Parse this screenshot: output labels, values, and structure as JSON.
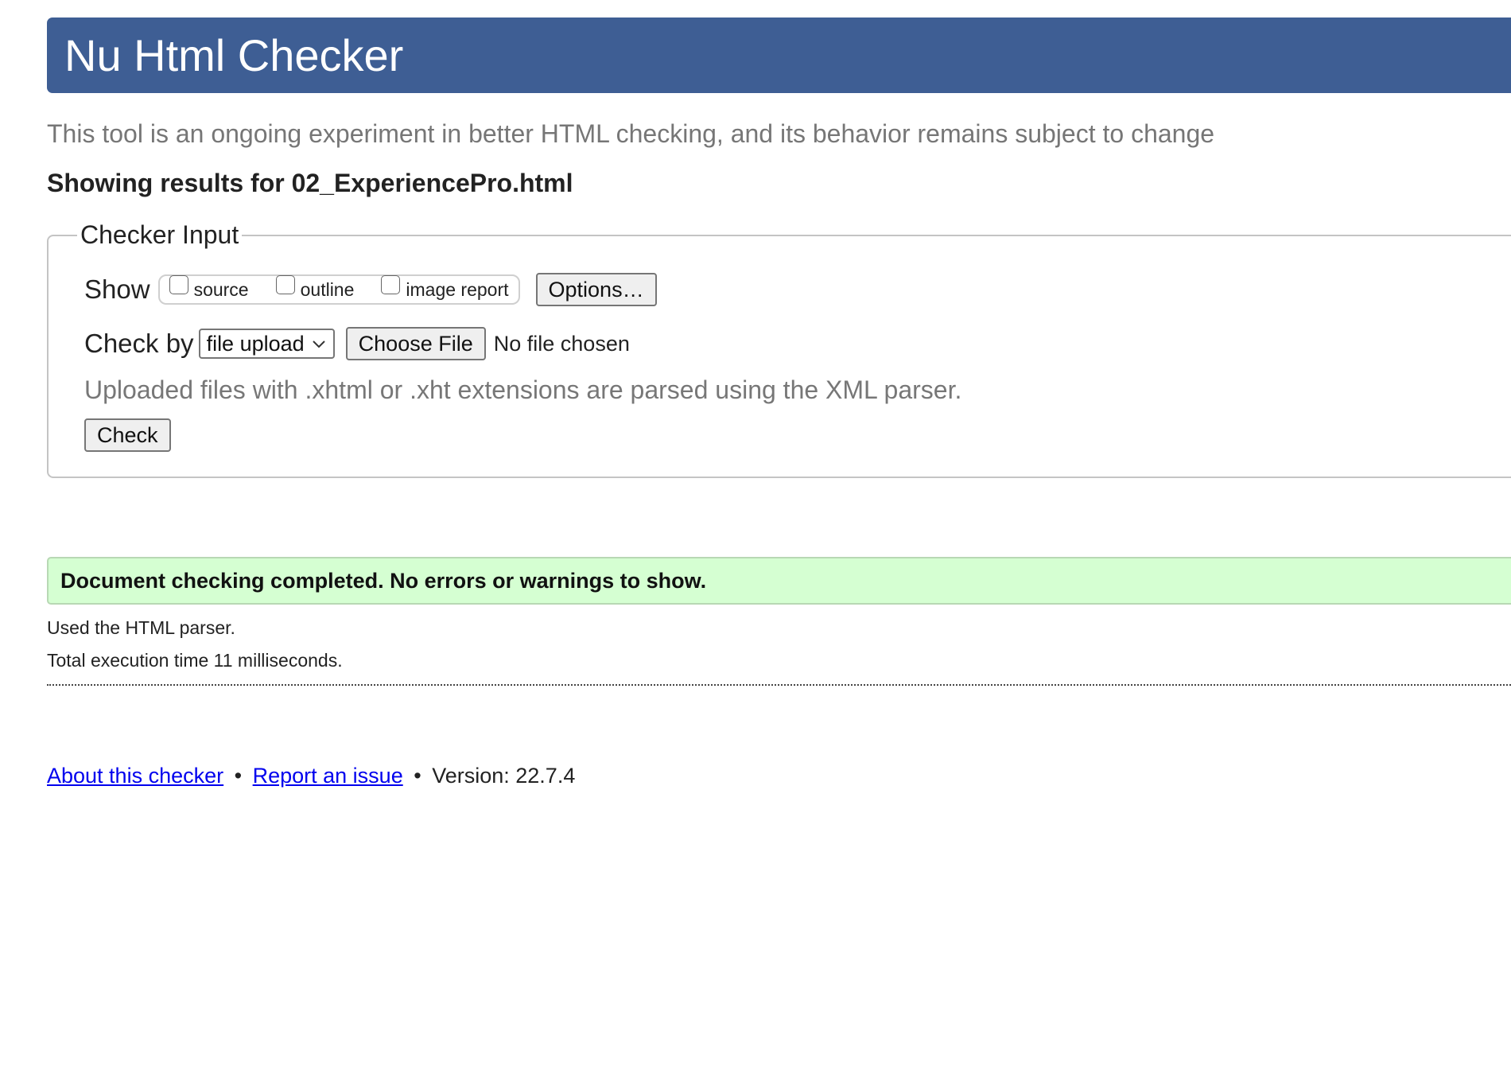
{
  "header": {
    "title": "Nu Html Checker",
    "background_color": "#3e5e94"
  },
  "subtitle": "This tool is an ongoing experiment in better HTML checking, and its behavior remains subject to change",
  "results_heading": "Showing results for 02_ExperiencePro.html",
  "checker_input": {
    "legend": "Checker Input",
    "show_label": "Show",
    "show_options": [
      {
        "label": "source",
        "checked": false
      },
      {
        "label": "outline",
        "checked": false
      },
      {
        "label": "image report",
        "checked": false
      }
    ],
    "options_button": "Options…",
    "check_by_label": "Check by",
    "check_by_selected": "file upload",
    "choose_file_button": "Choose File",
    "file_status": "No file chosen",
    "hint": "Uploaded files with .xhtml or .xht extensions are parsed using the XML parser.",
    "check_button": "Check"
  },
  "result": {
    "message": "Document checking completed. No errors or warnings to show.",
    "background_color": "#d5ffd2",
    "parser_note": "Used the HTML parser.",
    "execution_time": "Total execution time 11 milliseconds."
  },
  "footer": {
    "about_link": "About this checker",
    "separator": "•",
    "report_link": "Report an issue",
    "version": "Version: 22.7.4"
  }
}
